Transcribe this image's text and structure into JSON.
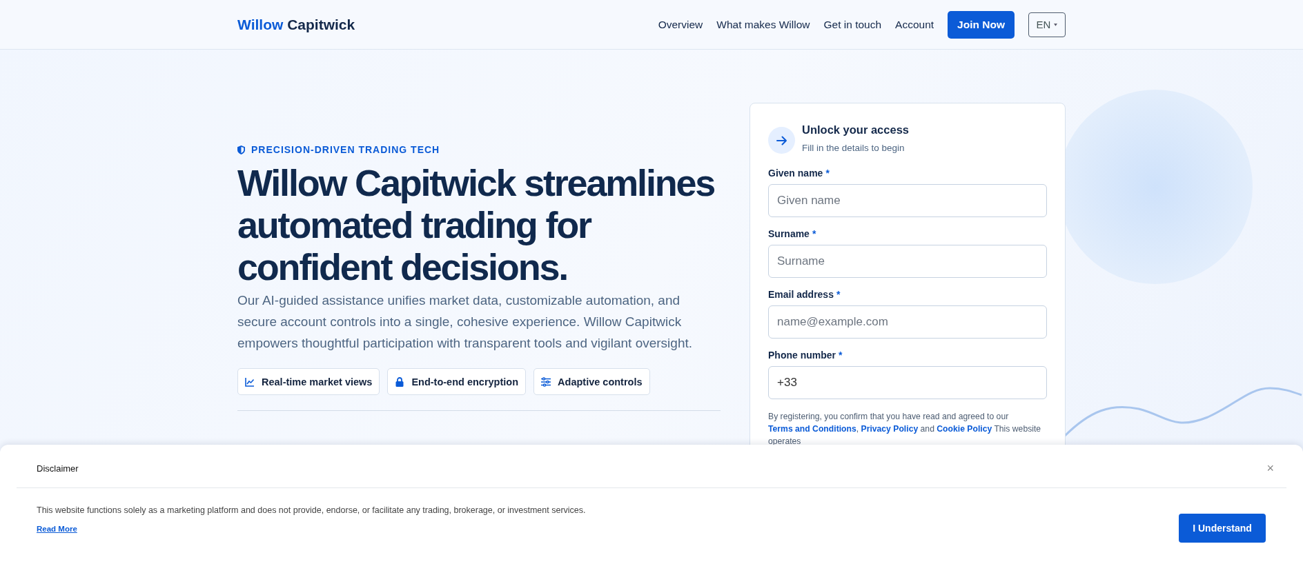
{
  "header": {
    "logo": {
      "accent": "Willow",
      "rest": "Capitwick"
    },
    "nav": [
      {
        "label": "Overview"
      },
      {
        "label": "What makes Willow"
      },
      {
        "label": "Get in touch"
      },
      {
        "label": "Account"
      }
    ],
    "join_button": "Join Now",
    "language": "EN"
  },
  "hero": {
    "eyebrow": "PRECISION-DRIVEN TRADING TECH",
    "headline": "Willow Capitwick streamlines automated trading for confident decisions.",
    "description": "Our AI-guided assistance unifies market data, customizable automation, and secure account controls into a single, cohesive experience. Willow Capitwick empowers thoughtful participation with transparent tools and vigilant oversight.",
    "features": [
      {
        "label": "Real-time market views",
        "kind": "chart"
      },
      {
        "label": "End-to-end encryption",
        "kind": "lock"
      },
      {
        "label": "Adaptive controls",
        "kind": "sliders"
      }
    ]
  },
  "form": {
    "title": "Unlock your access",
    "subtitle": "Fill in the details to begin",
    "fields": [
      {
        "label": "Given name",
        "required_mark": "*",
        "placeholder": "Given name"
      },
      {
        "label": "Surname",
        "required_mark": "*",
        "placeholder": "Surname"
      },
      {
        "label": "Email address",
        "required_mark": "*",
        "placeholder": "name@example.com"
      },
      {
        "label": "Phone number",
        "required_mark": "*",
        "value": "+33"
      }
    ],
    "consent": [
      {
        "kind": "text",
        "text": "By registering, you confirm that you have read and agreed to our "
      },
      {
        "kind": "link",
        "text": "Terms and Conditions"
      },
      {
        "kind": "text",
        "text": ", "
      },
      {
        "kind": "link",
        "text": "Privacy Policy"
      },
      {
        "kind": "text",
        "text": " and "
      },
      {
        "kind": "link",
        "text": "Cookie Policy"
      },
      {
        "kind": "text",
        "text": " This website operates"
      }
    ]
  },
  "disclaimer": {
    "title": "Disclaimer",
    "close": "×",
    "text": "This website functions solely as a marketing platform and does not provide, endorse, or facilitate any trading, brokerage, or investment services.",
    "link": "Read More",
    "button": "I Understand"
  }
}
